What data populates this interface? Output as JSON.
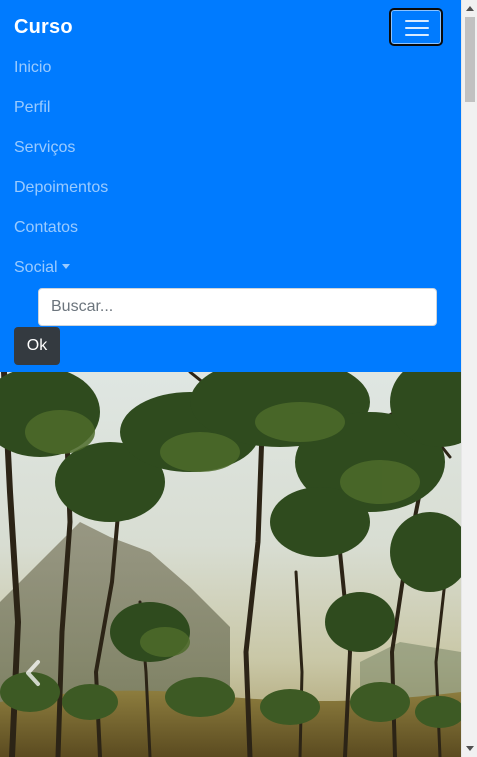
{
  "navbar": {
    "brand": "Curso",
    "background": "#007bff",
    "toggler_icon": "hamburger-icon",
    "items": [
      {
        "label": "Inicio"
      },
      {
        "label": "Perfil"
      },
      {
        "label": "Serviços"
      },
      {
        "label": "Depoimentos"
      },
      {
        "label": "Contatos"
      },
      {
        "label": "Social",
        "dropdown": true
      }
    ]
  },
  "search": {
    "placeholder": "Buscar...",
    "value": "",
    "button_label": "Ok",
    "button_color": "#343a40"
  },
  "carousel": {
    "prev_icon": "chevron-left-icon"
  }
}
